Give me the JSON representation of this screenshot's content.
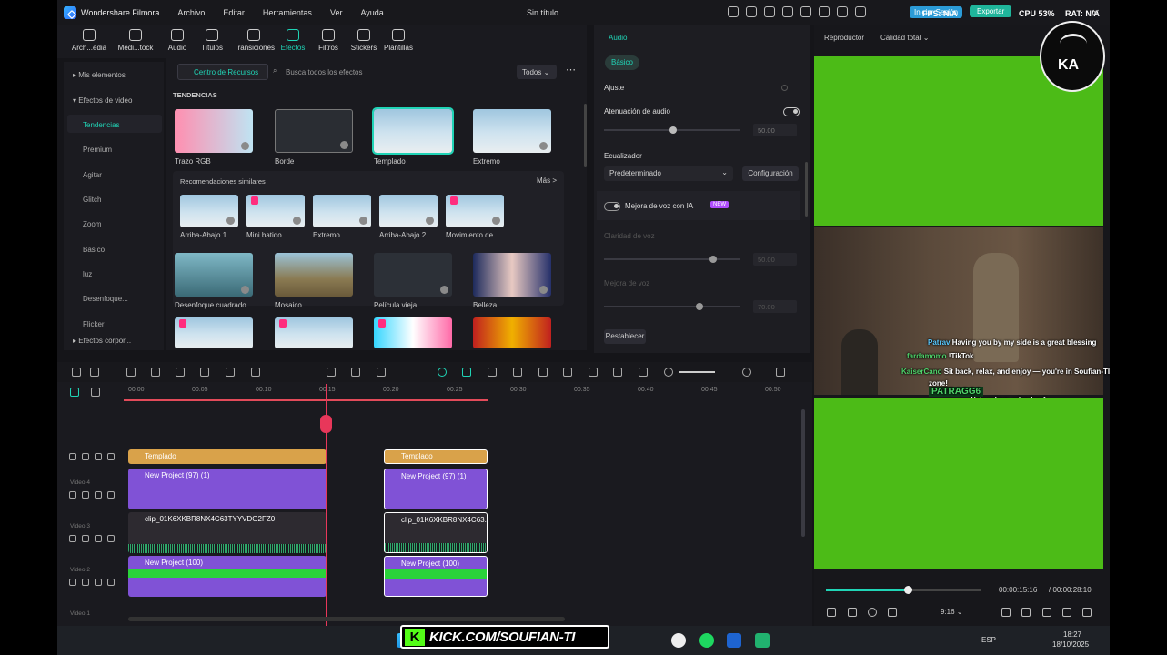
{
  "app": {
    "name": "Wondershare Filmora",
    "doc_title": "Sin título",
    "menu": [
      "Archivo",
      "Editar",
      "Herramientas",
      "Ver",
      "Ayuda"
    ],
    "signin": "Iniciar Sesión",
    "export": "Exportar",
    "fps": "FPS: N/A",
    "cpu": "CPU 53%",
    "mem": "RAT: N/A"
  },
  "toolbar": [
    {
      "label": "Arch...edia"
    },
    {
      "label": "Medi...tock"
    },
    {
      "label": "Audio"
    },
    {
      "label": "Títulos"
    },
    {
      "label": "Transiciones"
    },
    {
      "label": "Efectos",
      "active": true
    },
    {
      "label": "Filtros"
    },
    {
      "label": "Stickers"
    },
    {
      "label": "Plantillas"
    }
  ],
  "sidebar": {
    "mis_elementos": "Mis elementos",
    "efectos_video": "Efectos de video",
    "items": [
      "Tendencias",
      "Premium",
      "Agitar",
      "Glitch",
      "Zoom",
      "Básico",
      "luz",
      "Desenfoque...",
      "Flicker"
    ],
    "efectos_corpo": "Efectos corpor..."
  },
  "library": {
    "resource_center": "Centro de Recursos",
    "search_placeholder": "Busca todos los efectos",
    "filter": "Todos",
    "section_trending": "TENDENCIAS",
    "trending": [
      "Trazo RGB",
      "Borde",
      "Templado",
      "Extremo"
    ],
    "similar_title": "Recomendaciones similares",
    "more": "Más >",
    "similar": [
      "Arriba-Abajo 1",
      "Mini batido",
      "Extremo",
      "Arriba-Abajo 2",
      "Movimiento de ..."
    ],
    "row3": [
      "Desenfoque cuadrado",
      "Mosaico",
      "Película vieja",
      "Belleza"
    ]
  },
  "properties": {
    "tab": "Audio",
    "basic": "Básico",
    "ajuste": "Ajuste",
    "atenuacion": "Atenuación de audio",
    "atenuacion_val": "50.00",
    "ecualizador": "Ecualizador",
    "eq_preset": "Predeterminado",
    "config": "Configuración",
    "mejora_ia": "Mejora de voz con IA",
    "new_badge": "NEW",
    "claridad": "Claridad de voz",
    "claridad_val": "50.00",
    "mejora_voz": "Mejora de voz",
    "mejora_voz_val": "70.00",
    "reset": "Restablecer"
  },
  "player": {
    "title": "Reproductor",
    "quality": "Calidad total",
    "current": "00:00:15:16",
    "total": "/ 00:00:28:10",
    "ratio": "9:16",
    "progress": 0.53
  },
  "chat": [
    {
      "name": "Patrav",
      "msg": "Having you by my side is a great blessing"
    },
    {
      "name": "fardamomo",
      "msg": "!TikTok"
    },
    {
      "name": "KaiserCano",
      "msg": "Sit back, relax, and enjoy — you're in Soufian-TI's"
    },
    {
      "name": "",
      "msg": "zone!"
    },
    {
      "name": "PATRAGG6",
      "msg": ""
    },
    {
      "name": "",
      "msg": "Nchaadaya, wiya bzaf."
    }
  ],
  "timeline": {
    "ticks": [
      "00:00",
      "00:05",
      "00:10",
      "00:15",
      "00:20",
      "00:25",
      "00:30",
      "00:35",
      "00:40",
      "00:45",
      "00:50"
    ],
    "tracks": [
      "Video 4",
      "Video 3",
      "Video 2",
      "Video 1"
    ],
    "clip_templado": "Templado",
    "clip_project97": "New Project (97) (1)",
    "clip_video": "clip_01K6XKBR8NX4C63TYYVDG2FZ0",
    "clip_video_short": "clip_01K6XKBR8NX4C63...",
    "clip_project100": "New Project (100)"
  },
  "overlay": {
    "kick": "KICK.COM/SOUFIAN-TI",
    "emblem": "KA"
  },
  "taskbar": {
    "lang": "ESP",
    "time": "18:27",
    "date": "18/10/2025"
  }
}
